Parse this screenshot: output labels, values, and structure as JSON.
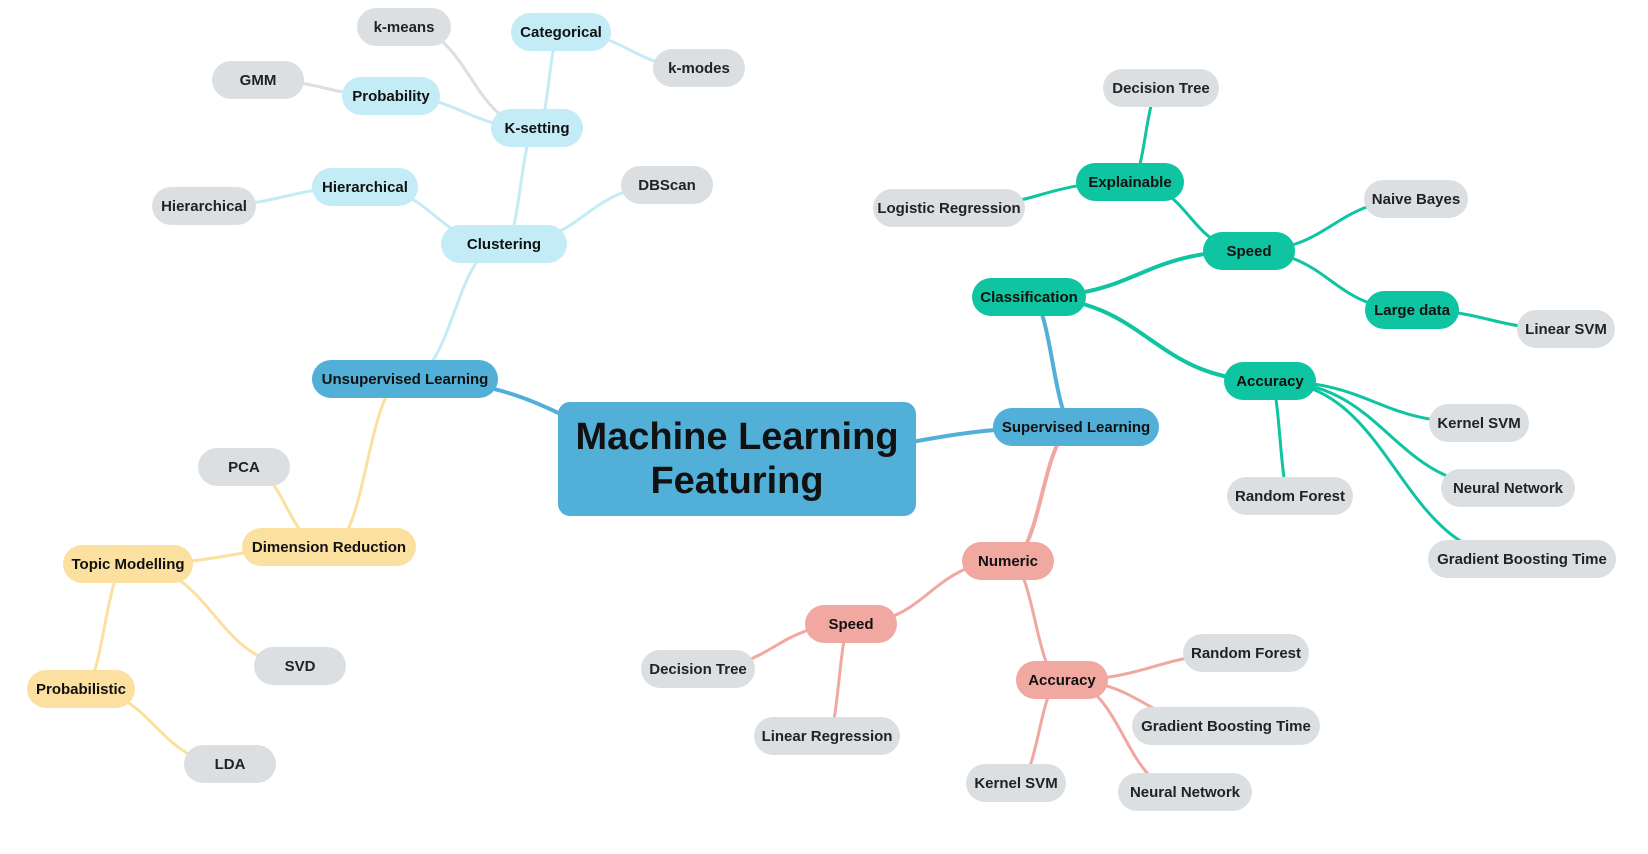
{
  "root": {
    "line1": "Machine Learning",
    "line2": "Featuring"
  },
  "colors": {
    "root": "#52b0d8",
    "branch": "#52b0d8",
    "clustering": "#c4ecf7",
    "dimension": "#fbe0a0",
    "classification": "#0ec4a1",
    "numeric": "#f1a8a0",
    "leaf": "#dcdfe1"
  },
  "nodes": {
    "unsupervised": "Unsupervised Learning",
    "supervised": "Supervised Learning",
    "clustering": "Clustering",
    "ksetting": "K-setting",
    "categorical": "Categorical",
    "kmeans": "k-means",
    "kmodes": "k-modes",
    "probability": "Probability",
    "gmm": "GMM",
    "hierarchical": "Hierarchical",
    "hierarchical_leaf": "Hierarchical",
    "dbscan": "DBScan",
    "dimreduction": "Dimension Reduction",
    "pca": "PCA",
    "topic": "Topic Modelling",
    "svd": "SVD",
    "probabilistic": "Probabilistic",
    "lda": "LDA",
    "classification": "Classification",
    "explainable": "Explainable",
    "dt_cls": "Decision Tree",
    "logreg": "Logistic Regression",
    "speed_cls": "Speed",
    "naive": "Naive Bayes",
    "largedata": "Large data",
    "linsvm": "Linear SVM",
    "accuracy_cls": "Accuracy",
    "kernelsvm_cls": "Kernel SVM",
    "nn_cls": "Neural Network",
    "gbt_cls": "Gradient Boosting Time",
    "rf_cls": "Random Forest",
    "numeric": "Numeric",
    "speed_num": "Speed",
    "dt_num": "Decision Tree",
    "linreg": "Linear Regression",
    "accuracy_num": "Accuracy",
    "rf_num": "Random Forest",
    "gbt_num": "Gradient Boosting Time",
    "kernelsvm_num": "Kernel SVM",
    "nn_num": "Neural Network"
  }
}
